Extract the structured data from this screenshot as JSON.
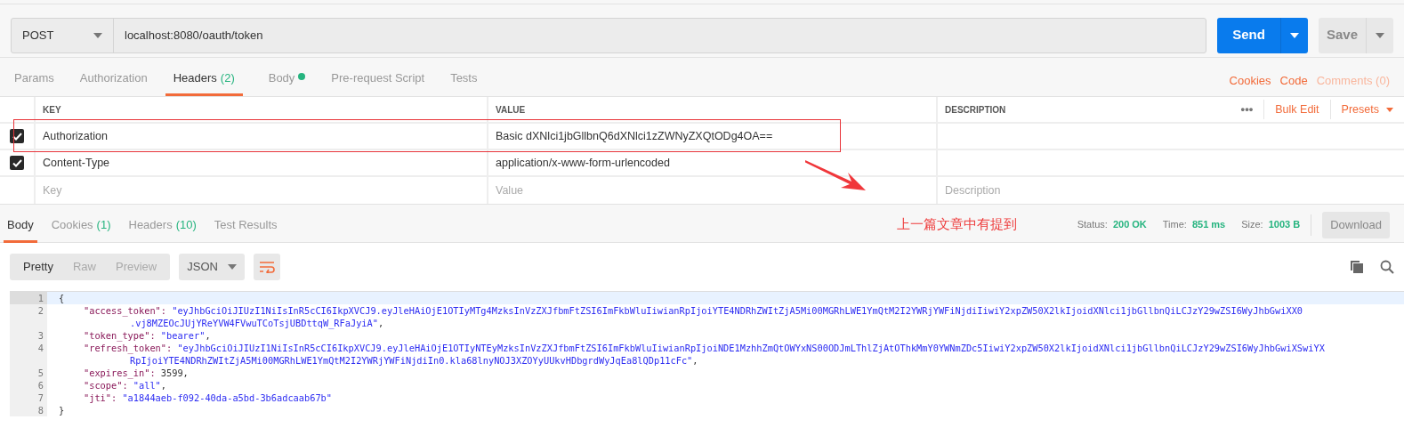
{
  "request": {
    "method": "POST",
    "url": "localhost:8080/oauth/token",
    "send": "Send",
    "save": "Save"
  },
  "request_tabs": [
    {
      "label": "Params",
      "selected": false
    },
    {
      "label": "Authorization",
      "selected": false
    },
    {
      "label": "Headers",
      "count": "(2)",
      "selected": true
    },
    {
      "label": "Body",
      "dot": true,
      "selected": false
    },
    {
      "label": "Pre-request Script",
      "selected": false
    },
    {
      "label": "Tests",
      "selected": false
    }
  ],
  "request_links": {
    "cookies": "Cookies",
    "code": "Code",
    "comments": "Comments (0)"
  },
  "headers_table": {
    "columns": [
      "KEY",
      "VALUE",
      "DESCRIPTION"
    ],
    "more": "•••",
    "bulk_edit": "Bulk Edit",
    "presets": "Presets",
    "rows": [
      {
        "key": "Authorization",
        "value": "Basic dXNlci1jbGllbnQ6dXNlci1zZWNyZXQtODg4OA==",
        "checked": true
      },
      {
        "key": "Content-Type",
        "value": "application/x-www-form-urlencoded",
        "checked": true
      }
    ],
    "new_row": [
      {
        "placeholder": "Key"
      },
      {
        "placeholder": "Value"
      },
      {
        "placeholder": "Description"
      }
    ]
  },
  "annotation": {
    "text": "上一篇文章中有提到"
  },
  "response_tabs": [
    {
      "label": "Body",
      "selected": true
    },
    {
      "label": "Cookies",
      "count": "(1)",
      "selected": false
    },
    {
      "label": "Headers",
      "count": "(10)",
      "selected": false
    },
    {
      "label": "Test Results",
      "selected": false
    }
  ],
  "response_status": {
    "status_label": "Status:",
    "status": "200 OK",
    "time_label": "Time:",
    "time": "851 ms",
    "size_label": "Size:",
    "size": "1003 B",
    "download": "Download"
  },
  "view_modes": [
    {
      "label": "Pretty",
      "selected": true
    },
    {
      "label": "Raw",
      "selected": false
    },
    {
      "label": "Preview",
      "selected": false
    }
  ],
  "format": "JSON",
  "code_lines": [
    {
      "number": "1",
      "text": "{"
    },
    {
      "number": "2",
      "key": "\"access_token\": ",
      "kind": "string",
      "value_rows": [
        "\"eyJhbGciOiJIUzI1NiIsInR5cCI6IkpXVCJ9.eyJleHAiOjE1OTIyMTg4MzksInVzZXJfbmFtZSI6ImFkbWluIiwianRpIjoiYTE4NDRhZWItZjA5Mi00MGRhLWE1YmQtM2I2YWRjYWFiNjdiIiwiY2xpZW50X2lkIjoidXNlci1jbGllbnQiLCJzY29wZSI6WyJhbGwiXX0",
        ".vj8MZEOcJUjYReYVW4FVwuTCoTsjUBDttqW_RFaJyiA\""
      ],
      "trail": ","
    },
    {
      "number": "3",
      "key": "\"token_type\": ",
      "kind": "string",
      "value_rows": [
        "\"bearer\""
      ],
      "trail": ","
    },
    {
      "number": "4",
      "key": "\"refresh_token\": ",
      "kind": "string",
      "value_rows": [
        "\"eyJhbGciOiJIUzI1NiIsInR5cCI6IkpXVCJ9.eyJleHAiOjE1OTIyNTEyMzksInVzZXJfbmFtZSI6ImFkbWluIiwianRpIjoiNDE1MzhhZmQtOWYxNS00ODJmLThlZjAtOThkMmY0YWNmZDc5IiwiY2xpZW50X2lkIjoidXNlci1jbGllbnQiLCJzY29wZSI6WyJhbGwiXSwiYX",
        "RpIjoiYTE4NDRhZWItZjA5Mi00MGRhLWE1YmQtM2I2YWRjYWFiNjdiIn0.kla68lnyNOJ3XZOYyUUkvHDbgrdWyJqEa8lQDp11cFc\""
      ],
      "trail": ","
    },
    {
      "number": "5",
      "key": "\"expires_in\": ",
      "kind": "number",
      "value_rows": [
        "3599"
      ],
      "trail": ","
    },
    {
      "number": "6",
      "key": "\"scope\": ",
      "kind": "string",
      "value_rows": [
        "\"all\""
      ],
      "trail": ","
    },
    {
      "number": "7",
      "key": "\"jti\": ",
      "kind": "string",
      "value_rows": [
        "\"a1844aeb-f092-40da-a5bd-3b6adcaab67b\""
      ]
    },
    {
      "number": "8",
      "text": "}"
    }
  ]
}
